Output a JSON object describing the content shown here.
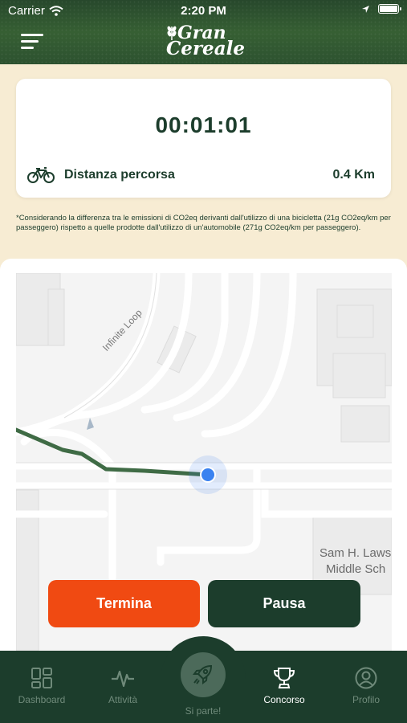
{
  "status_bar": {
    "carrier": "Carrier",
    "time": "2:20 PM"
  },
  "brand": {
    "line1": "Gran",
    "line2": "Cereale"
  },
  "timer": {
    "elapsed": "00:01:01",
    "distance_label": "Distanza percorsa",
    "distance_value": "0.4 Km"
  },
  "note": "*Considerando la differenza tra le emissioni di CO2eq derivanti dall'utilizzo di una bicicletta (21g CO2eq/km per passeggero) rispetto a quelle prodotte dall'utilizzo di un'automobile (271g CO2eq/km per passeggero).",
  "map": {
    "street_label": "Infinite Loop",
    "poi_line1": "Sam H. Laws",
    "poi_line2": "Middle Sch",
    "route_color": "#3f6b45",
    "location_color": "#3a82f0"
  },
  "actions": {
    "stop_label": "Termina",
    "pause_label": "Pausa"
  },
  "tabs": [
    {
      "label": "Dashboard",
      "icon": "dashboard-icon",
      "active": false
    },
    {
      "label": "Attività",
      "icon": "activity-icon",
      "active": false
    },
    {
      "label": "Si parte!",
      "icon": "rocket-icon",
      "active": false
    },
    {
      "label": "Concorso",
      "icon": "trophy-icon",
      "active": true
    },
    {
      "label": "Profilo",
      "icon": "profile-icon",
      "active": false
    }
  ],
  "colors": {
    "primary": "#1c3d2c",
    "accent": "#f04a12",
    "background": "#f7ecd3"
  }
}
